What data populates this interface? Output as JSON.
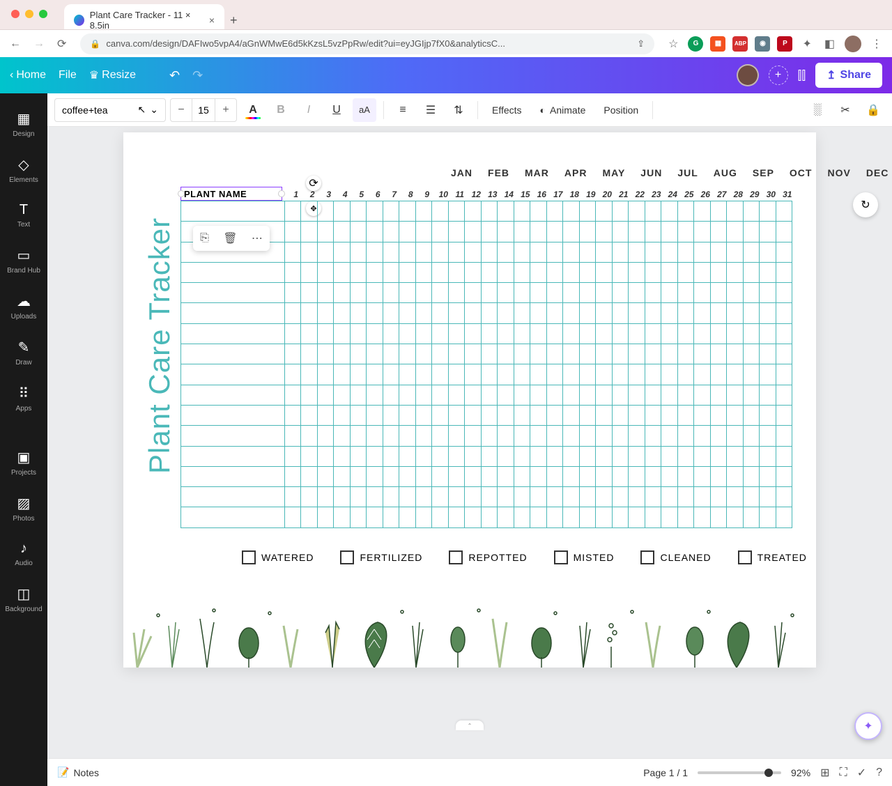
{
  "browser": {
    "tab_title": "Plant Care Tracker - 11 × 8.5in",
    "url": "canva.com/design/DAFIwo5vpA4/aGnWMwE6d5kKzsL5vzPpRw/edit?ui=eyJGIjp7fX0&analyticsC..."
  },
  "topbar": {
    "home": "Home",
    "file": "File",
    "resize": "Resize",
    "share": "Share"
  },
  "sidebar": {
    "items": [
      {
        "label": "Design",
        "icon": "▦"
      },
      {
        "label": "Elements",
        "icon": "◇△"
      },
      {
        "label": "Text",
        "icon": "T"
      },
      {
        "label": "Brand Hub",
        "icon": "▭"
      },
      {
        "label": "Uploads",
        "icon": "☁"
      },
      {
        "label": "Draw",
        "icon": "✎"
      },
      {
        "label": "Apps",
        "icon": "⋮⋮"
      },
      {
        "label": "Projects",
        "icon": "▣"
      },
      {
        "label": "Photos",
        "icon": "▨"
      },
      {
        "label": "Audio",
        "icon": "♪"
      },
      {
        "label": "Background",
        "icon": "◫"
      }
    ]
  },
  "text_toolbar": {
    "font": "coffee+tea",
    "size": "15",
    "effects": "Effects",
    "animate": "Animate",
    "position": "Position"
  },
  "canvas": {
    "selected_text": "PLANT NAME",
    "vert_title": "Plant Care Tracker",
    "months": [
      "JAN",
      "FEB",
      "MAR",
      "APR",
      "MAY",
      "JUN",
      "JUL",
      "AUG",
      "SEP",
      "OCT",
      "NOV",
      "DEC"
    ],
    "days": [
      "1",
      "2",
      "3",
      "4",
      "5",
      "6",
      "7",
      "8",
      "9",
      "10",
      "11",
      "12",
      "13",
      "14",
      "15",
      "16",
      "17",
      "18",
      "19",
      "20",
      "21",
      "22",
      "23",
      "24",
      "25",
      "26",
      "27",
      "28",
      "29",
      "30",
      "31"
    ],
    "legend": [
      "WATERED",
      "FERTILIZED",
      "REPOTTED",
      "MISTED",
      "CLEANED",
      "TREATED"
    ]
  },
  "bottom": {
    "notes": "Notes",
    "page": "Page 1 / 1",
    "zoom": "92%"
  }
}
